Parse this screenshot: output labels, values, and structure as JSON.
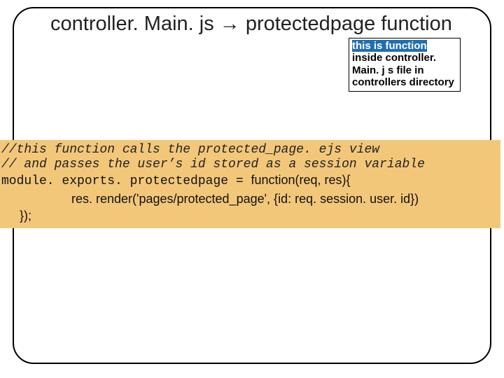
{
  "title": "controller. Main. js → protectedpage function",
  "callout": {
    "hl": "this is function",
    "rest": "inside controller. Main. j s  file in controllers directory"
  },
  "code": {
    "c1": "//this function calls the protected_page. ejs view",
    "c2": "// and passes the user’s id stored as a session variable",
    "l1a": "module. exports. protectedpage = ",
    "l1b": "function(req, res){",
    "l2": "res. render('pages/protected_page', {id: req. session. user. id})",
    "l3": "});"
  }
}
